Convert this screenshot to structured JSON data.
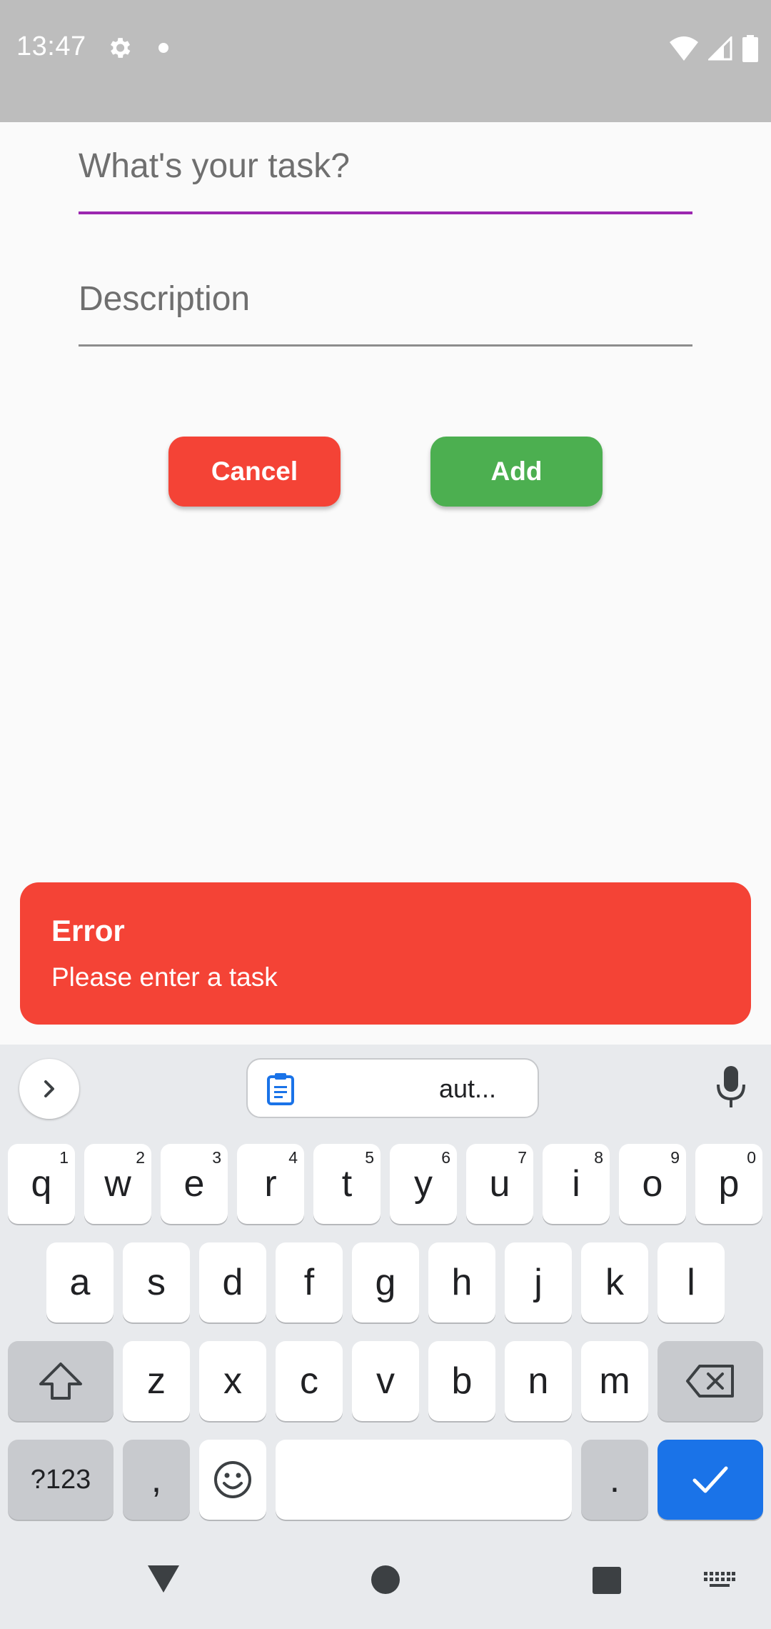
{
  "status_bar": {
    "time": "13:47"
  },
  "form": {
    "task_placeholder": "What's your task?",
    "description_placeholder": "Description",
    "cancel_label": "Cancel",
    "add_label": "Add"
  },
  "snackbar": {
    "title": "Error",
    "message": "Please enter a task"
  },
  "keyboard": {
    "clipboard_suggestion": "aut...",
    "row1": [
      {
        "label": "q",
        "hint": "1"
      },
      {
        "label": "w",
        "hint": "2"
      },
      {
        "label": "e",
        "hint": "3"
      },
      {
        "label": "r",
        "hint": "4"
      },
      {
        "label": "t",
        "hint": "5"
      },
      {
        "label": "y",
        "hint": "6"
      },
      {
        "label": "u",
        "hint": "7"
      },
      {
        "label": "i",
        "hint": "8"
      },
      {
        "label": "o",
        "hint": "9"
      },
      {
        "label": "p",
        "hint": "0"
      }
    ],
    "row2": [
      "a",
      "s",
      "d",
      "f",
      "g",
      "h",
      "j",
      "k",
      "l"
    ],
    "row3": [
      "z",
      "x",
      "c",
      "v",
      "b",
      "n",
      "m"
    ],
    "symbols_label": "?123",
    "comma_label": ",",
    "period_label": "."
  },
  "colors": {
    "status_bar": "#bdbdbd",
    "focused_underline": "#9c27b0",
    "cancel": "#f44336",
    "add": "#4caf50",
    "error": "#f44336",
    "enter_key": "#1a73e8"
  }
}
